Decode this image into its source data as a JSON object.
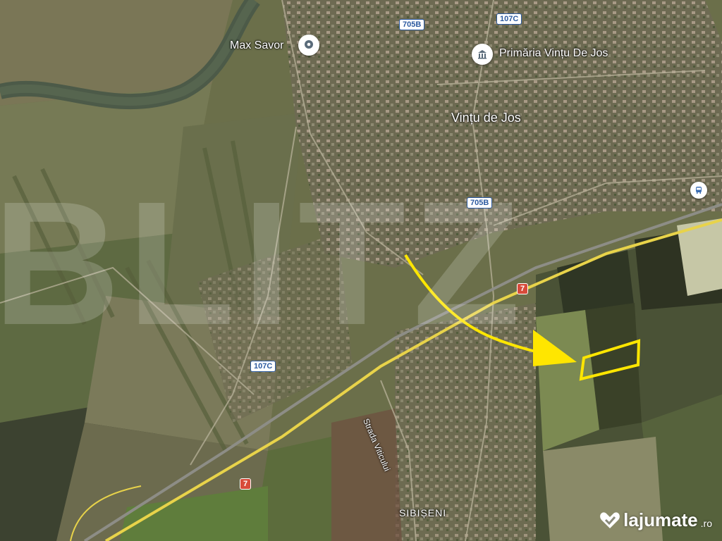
{
  "colors": {
    "terrain_base": "#6b6f4a",
    "field_dark": "#3f4430",
    "field_green": "#6f8a4a",
    "river": "#53604a",
    "highway": "#e8d34a",
    "annotation": "#ffe600",
    "shield_blue": "#2c5aa0",
    "shield_red": "#d84b3b"
  },
  "places": {
    "max_savor": "Max Savor",
    "primaria": "Primăria Vințu De Jos",
    "vintu": "Vințu de Jos",
    "sibiseni": "SIBIȘENI",
    "strada": "Strada Viticului"
  },
  "roads": {
    "r705b_top": "705B",
    "r107c_top": "107C",
    "r705b_mid": "705B",
    "r7_mid": "7",
    "r107c_low": "107C",
    "r7_low": "7"
  },
  "icons": {
    "place_pin": "location-pin-icon",
    "townhall_pin": "townhall-icon",
    "transit": "bus-station-icon"
  },
  "watermark": "BLITZ",
  "brand": {
    "name": "lajumate",
    "tld": ".ro"
  }
}
